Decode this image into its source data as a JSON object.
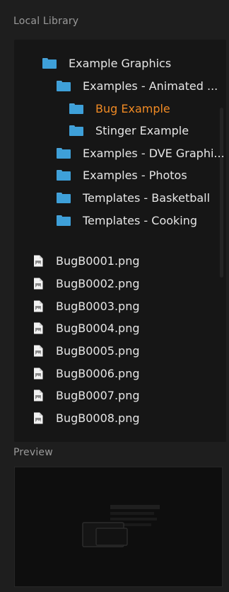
{
  "library": {
    "title": "Local Library",
    "tree": [
      {
        "label": "Example Graphics",
        "selected": false
      },
      {
        "label": "Examples - Animated ...",
        "selected": false
      },
      {
        "label": "Bug Example",
        "selected": true
      },
      {
        "label": "Stinger Example",
        "selected": false
      },
      {
        "label": "Examples - DVE Graphi...",
        "selected": false
      },
      {
        "label": "Examples - Photos",
        "selected": false
      },
      {
        "label": "Templates - Basketball",
        "selected": false
      },
      {
        "label": "Templates - Cooking",
        "selected": false
      }
    ],
    "files": [
      "BugB0001.png",
      "BugB0002.png",
      "BugB0003.png",
      "BugB0004.png",
      "BugB0005.png",
      "BugB0006.png",
      "BugB0007.png",
      "BugB0008.png"
    ]
  },
  "preview": {
    "title": "Preview"
  },
  "colors": {
    "folder": "#3ea0d9",
    "selected_text": "#f08a24",
    "panel_bg": "#1e1e1e"
  }
}
